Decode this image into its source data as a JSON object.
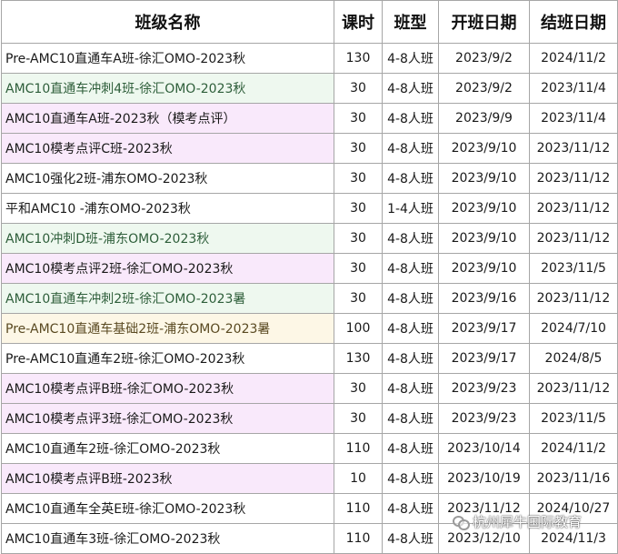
{
  "headers": {
    "name": "班级名称",
    "hours": "课时",
    "type": "班型",
    "start": "开班日期",
    "end": "结班日期"
  },
  "rows": [
    {
      "name": "Pre-AMC10直通车A班-徐汇OMO-2023秋",
      "hours": "130",
      "type": "4-8人班",
      "start": "2023/9/2",
      "end": "2024/11/2",
      "color": "white"
    },
    {
      "name": "AMC10直通车冲刺4班-徐汇OMO-2023秋",
      "hours": "30",
      "type": "4-8人班",
      "start": "2023/9/2",
      "end": "2023/11/4",
      "color": "green"
    },
    {
      "name": "AMC10直通车A班-2023秋（模考点评）",
      "hours": "30",
      "type": "4-8人班",
      "start": "2023/9/9",
      "end": "2023/11/4",
      "color": "pink"
    },
    {
      "name": "AMC10模考点评C班-2023秋",
      "hours": "30",
      "type": "4-8人班",
      "start": "2023/9/10",
      "end": "2023/11/12",
      "color": "pink"
    },
    {
      "name": "AMC10强化2班-浦东OMO-2023秋",
      "hours": "30",
      "type": "4-8人班",
      "start": "2023/9/10",
      "end": "2023/11/12",
      "color": "white"
    },
    {
      "name": "平和AMC10 -浦东OMO-2023秋",
      "hours": "30",
      "type": "1-4人班",
      "start": "2023/9/10",
      "end": "2023/11/12",
      "color": "white"
    },
    {
      "name": "AMC10冲刺D班-浦东OMO-2023秋",
      "hours": "30",
      "type": "4-8人班",
      "start": "2023/9/10",
      "end": "2023/11/12",
      "color": "green"
    },
    {
      "name": "AMC10模考点评2班-徐汇OMO-2023秋",
      "hours": "30",
      "type": "4-8人班",
      "start": "2023/9/10",
      "end": "2023/11/5",
      "color": "pink"
    },
    {
      "name": "AMC10直通车冲刺2班-徐汇OMO-2023暑",
      "hours": "30",
      "type": "4-8人班",
      "start": "2023/9/16",
      "end": "2023/11/12",
      "color": "green"
    },
    {
      "name": "Pre-AMC10直通车基础2班-浦东OMO-2023暑",
      "hours": "100",
      "type": "4-8人班",
      "start": "2023/9/17",
      "end": "2024/7/10",
      "color": "yellow"
    },
    {
      "name": "Pre-AMC10直通车2班-徐汇OMO-2023秋",
      "hours": "130",
      "type": "4-8人班",
      "start": "2023/9/17",
      "end": "2024/8/5",
      "color": "white"
    },
    {
      "name": "AMC10模考点评B班-徐汇OMO-2023秋",
      "hours": "30",
      "type": "4-8人班",
      "start": "2023/9/23",
      "end": "2023/11/12",
      "color": "pink"
    },
    {
      "name": "AMC10模考点评3班-徐汇OMO-2023秋",
      "hours": "30",
      "type": "4-8人班",
      "start": "2023/9/23",
      "end": "2023/11/5",
      "color": "pink"
    },
    {
      "name": "AMC10直通车2班-徐汇OMO-2023秋",
      "hours": "110",
      "type": "4-8人班",
      "start": "2023/10/14",
      "end": "2024/11/2",
      "color": "white"
    },
    {
      "name": "AMC10模考点评B班-2023秋",
      "hours": "10",
      "type": "4-8人班",
      "start": "2023/10/19",
      "end": "2023/11/16",
      "color": "pink"
    },
    {
      "name": "AMC10直通车全英E班-徐汇OMO-2023秋",
      "hours": "110",
      "type": "4-8人班",
      "start": "2023/11/12",
      "end": "2024/10/27",
      "color": "white"
    },
    {
      "name": "AMC10直通车3班-徐汇OMO-2023秋",
      "hours": "110",
      "type": "4-8人班",
      "start": "2023/12/10",
      "end": "2024/11/3",
      "color": "white"
    }
  ],
  "watermark": "杭州犀牛国际教育"
}
